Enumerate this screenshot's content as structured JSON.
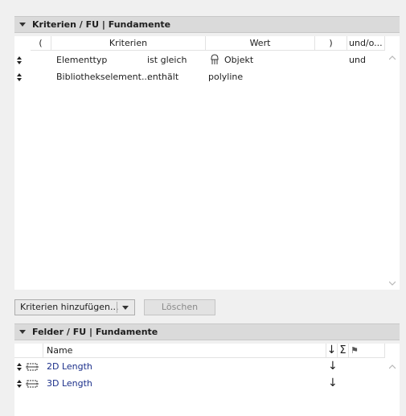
{
  "criteria": {
    "header": "Kriterien / FU | Fundamente",
    "columns": [
      "(",
      "Kriterien",
      "Wert",
      ")",
      "und/o..."
    ],
    "rows": [
      {
        "name": "Elementtyp",
        "op": "ist gleich",
        "value": "Objekt",
        "conj": "und"
      },
      {
        "name": "Bibliothekselement...",
        "op": "enthält",
        "value": "polyline",
        "conj": ""
      }
    ]
  },
  "buttons": {
    "add_criteria": "Kriterien hinzufügen...",
    "delete": "Löschen"
  },
  "fields": {
    "header": "Felder / FU | Fundamente",
    "columns": {
      "name": "Name",
      "sort": "↓",
      "sum": "Σ",
      "flag": "⚑"
    },
    "rows": [
      {
        "name": "2D Length",
        "sort": "↓"
      },
      {
        "name": "3D Length",
        "sort": "↓"
      }
    ]
  },
  "colors": {
    "link": "#1b2f8a",
    "header_bg": "#dadada",
    "panel_bg": "#ffffff"
  }
}
